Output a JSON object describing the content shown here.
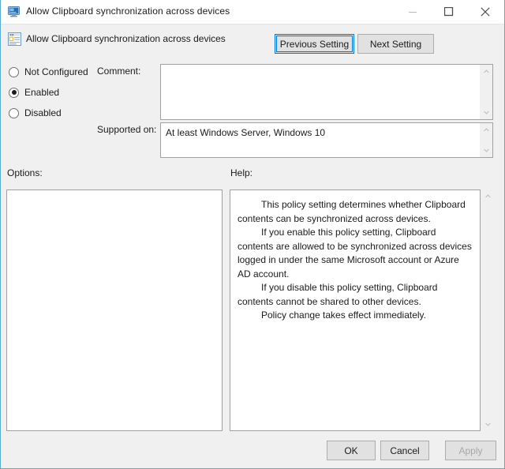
{
  "window": {
    "title": "Allow Clipboard synchronization across devices",
    "icon": "monitor-policy-icon",
    "controls": {
      "minimize": "minimize-icon",
      "maximize": "maximize-icon",
      "close": "close-icon"
    }
  },
  "header": {
    "policy_title": "Allow Clipboard synchronization across devices",
    "icon": "policy-setting-icon",
    "previous_setting": "Previous Setting",
    "next_setting": "Next Setting"
  },
  "state_options": {
    "items": [
      {
        "label": "Not Configured",
        "checked": false
      },
      {
        "label": "Enabled",
        "checked": true
      },
      {
        "label": "Disabled",
        "checked": false
      }
    ]
  },
  "comment": {
    "label": "Comment:",
    "value": "",
    "placeholder": ""
  },
  "supported_on": {
    "label": "Supported on:",
    "value": "At least Windows Server, Windows 10"
  },
  "options": {
    "label": "Options:",
    "content": ""
  },
  "help": {
    "label": "Help:",
    "paragraphs": [
      "This policy setting determines whether Clipboard contents can be synchronized across devices.",
      "If you enable this policy setting, Clipboard contents are allowed to be synchronized across devices logged in under the same Microsoft account or Azure AD account.",
      "If you disable this policy setting, Clipboard contents cannot be shared to other devices.",
      "Policy change takes effect immediately."
    ]
  },
  "footer": {
    "ok": "OK",
    "cancel": "Cancel",
    "apply": "Apply",
    "apply_disabled": true
  },
  "colors": {
    "dialog_border": "#5babcf",
    "focus_ring": "#0078d7",
    "face": "#f0f0f0",
    "button_face": "#e1e1e1",
    "text": "#1b1b1b",
    "disabled_text": "#a7a7a7"
  }
}
